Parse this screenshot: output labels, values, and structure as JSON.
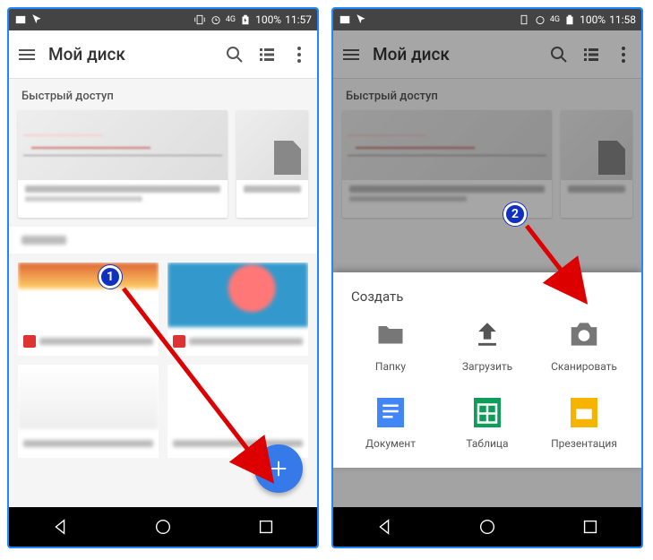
{
  "status": {
    "battery": "100%",
    "time1": "11:57",
    "time2": "11:58",
    "net": "4G"
  },
  "appbar": {
    "title": "Мой диск"
  },
  "quick_label": "Быстрый доступ",
  "sheet": {
    "title": "Создать",
    "items": [
      {
        "key": "folder",
        "label": "Папку"
      },
      {
        "key": "upload",
        "label": "Загрузить"
      },
      {
        "key": "scan",
        "label": "Сканировать"
      },
      {
        "key": "doc",
        "label": "Документ"
      },
      {
        "key": "sheet",
        "label": "Таблица"
      },
      {
        "key": "slides",
        "label": "Презентация"
      }
    ]
  },
  "annotations": {
    "badge1": "1",
    "badge2": "2"
  }
}
